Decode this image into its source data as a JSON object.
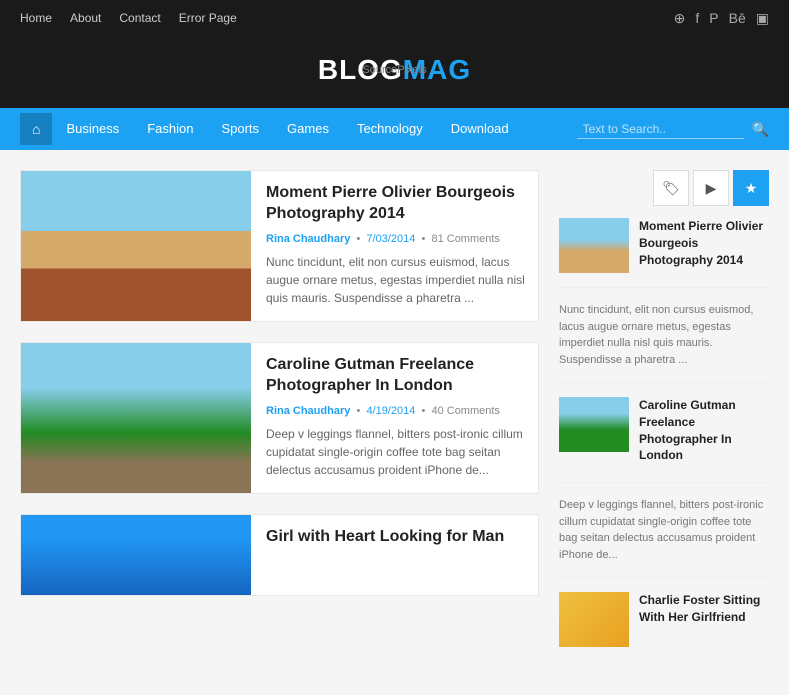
{
  "topNav": {
    "links": [
      {
        "label": "Home",
        "name": "home"
      },
      {
        "label": "About",
        "name": "about"
      },
      {
        "label": "Contact",
        "name": "contact"
      },
      {
        "label": "Error Page",
        "name": "error-page"
      }
    ],
    "icons": [
      "globe",
      "facebook",
      "pinterest",
      "behance",
      "instagram"
    ]
  },
  "header": {
    "logo_blog": "BLOG",
    "logo_mag": "MAG",
    "watermark": "SourcePixels"
  },
  "catNav": {
    "home_icon": "⌂",
    "links": [
      {
        "label": "Business"
      },
      {
        "label": "Fashion"
      },
      {
        "label": "Sports"
      },
      {
        "label": "Games"
      },
      {
        "label": "Technology"
      },
      {
        "label": "Download"
      }
    ],
    "search_placeholder": "Text to Search.."
  },
  "articles": [
    {
      "title": "Moment Pierre Olivier Bourgeois Photography 2014",
      "author": "Rina Chaudhary",
      "date": "7/03/2014",
      "comments": "81 Comments",
      "excerpt": "Nunc tincidunt, elit non cursus euismod, lacus augue ornare metus, egestas imperdiet nulla nisl quis mauris. Suspendisse a pharetra ...",
      "image_class": "img-beach"
    },
    {
      "title": "Caroline Gutman Freelance Photographer In London",
      "author": "Rina Chaudhary",
      "date": "4/19/2014",
      "comments": "40 Comments",
      "excerpt": "Deep v leggings flannel, bitters post-ironic cillum cupidatat single-origin coffee tote bag seitan delectus accusamus proident iPhone de...",
      "image_class": "img-van"
    }
  ],
  "partialArticle": {
    "title": "Girl with Heart Looking for Man"
  },
  "sidebar": {
    "tabs": [
      {
        "icon": "🏷",
        "label": "tag",
        "active": false
      },
      {
        "icon": "▶",
        "label": "video",
        "active": false
      },
      {
        "icon": "★",
        "label": "star",
        "active": true
      }
    ],
    "items": [
      {
        "title": "Moment Pierre Olivier Bourgeois Photography 2014",
        "excerpt": "Nunc tincidunt, elit non cursus euismod, lacus augue ornare metus, egestas imperdiet nulla nisl quis mauris. Suspendisse a pharetra ...",
        "image_class": "img-thumb1"
      },
      {
        "title": "Caroline Gutman Freelance Photographer In London",
        "excerpt": "Deep v leggings flannel, bitters post-ironic cillum cupidatat single-origin coffee tote bag seitan delectus accusamus proident iPhone de...",
        "image_class": "img-thumb2"
      },
      {
        "title": "Charlie Foster Sitting With Her Girlfriend",
        "excerpt": "",
        "image_class": "img-thumb3"
      }
    ]
  }
}
